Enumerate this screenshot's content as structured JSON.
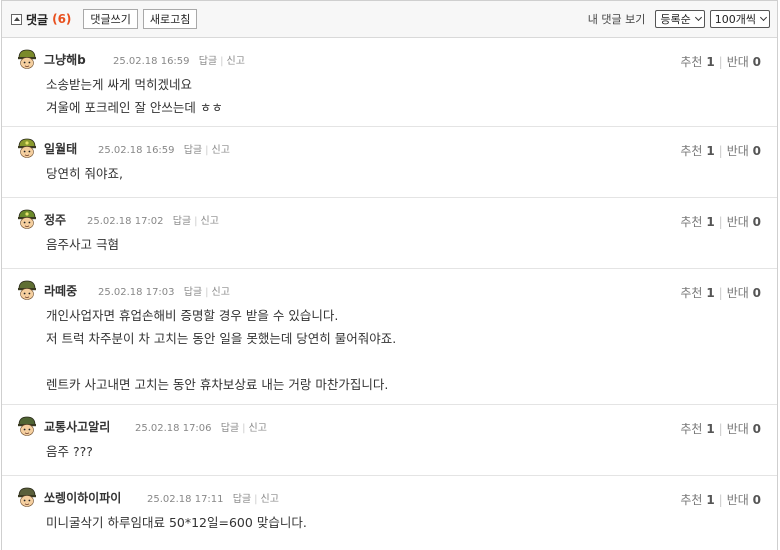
{
  "header": {
    "title": "댓글",
    "count": "(6)",
    "write_button": "댓글쓰기",
    "refresh_button": "새로고침",
    "my_comments": "내 댓글 보기",
    "sort_select": "등록순",
    "per_page_select": "100개씩"
  },
  "labels": {
    "reply": "답글",
    "report": "신고",
    "recommend": "추천",
    "oppose": "반대"
  },
  "comments": [
    {
      "nick": "그냥해b",
      "time": "25.02.18 16:59",
      "up": "1",
      "down": "0",
      "lines": [
        "소송받는게 싸게 먹히겠네요",
        "겨울에 포크레인 잘 안쓰는데 ㅎㅎ"
      ]
    },
    {
      "nick": "일월태",
      "time": "25.02.18 16:59",
      "up": "1",
      "down": "0",
      "lines": [
        "당연히 줘야죠,"
      ]
    },
    {
      "nick": "정주",
      "time": "25.02.18 17:02",
      "up": "1",
      "down": "0",
      "lines": [
        "음주사고 극혐"
      ]
    },
    {
      "nick": "라떼중",
      "time": "25.02.18 17:03",
      "up": "1",
      "down": "0",
      "lines": [
        "개인사업자면 휴업손해비 증명할 경우 받을 수 있습니다.",
        "저 트럭 차주분이 차 고치는 동안 일을 못했는데 당연히 물어줘야죠.",
        "",
        "렌트카 사고내면 고치는 동안 휴차보상료 내는 거랑 마찬가집니다."
      ]
    },
    {
      "nick": "교통사고알리",
      "time": "25.02.18 17:06",
      "up": "1",
      "down": "0",
      "lines": [
        "음주 ???"
      ]
    },
    {
      "nick": "쏘렝이하이파이",
      "time": "25.02.18 17:11",
      "up": "1",
      "down": "0",
      "lines": [
        "미니굴삭기 하루임대료 50*12일=600 맞습니다."
      ]
    }
  ]
}
